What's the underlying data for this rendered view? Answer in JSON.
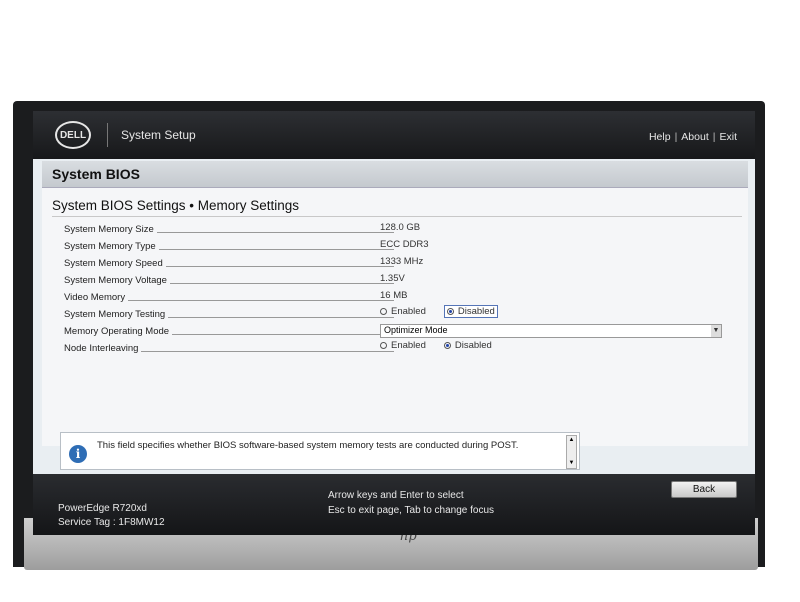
{
  "header": {
    "logo": "DELL",
    "title": "System Setup",
    "links": [
      "Help",
      "About",
      "Exit"
    ]
  },
  "section_title": "System BIOS",
  "subtitle": "System BIOS Settings • Memory Settings",
  "settings": {
    "memory_size": {
      "label": "System Memory Size",
      "value": "128.0 GB"
    },
    "memory_type": {
      "label": "System Memory Type",
      "value": "ECC DDR3"
    },
    "memory_speed": {
      "label": "System Memory Speed",
      "value": "1333 MHz"
    },
    "memory_voltage": {
      "label": "System Memory Voltage",
      "value": "1.35V"
    },
    "video_memory": {
      "label": "Video Memory",
      "value": "16 MB"
    },
    "memory_testing": {
      "label": "System Memory Testing",
      "options": [
        "Enabled",
        "Disabled"
      ],
      "selected": "Disabled"
    },
    "operating_mode": {
      "label": "Memory Operating Mode",
      "value": "Optimizer Mode"
    },
    "node_interleaving": {
      "label": "Node Interleaving",
      "options": [
        "Enabled",
        "Disabled"
      ],
      "selected": "Disabled"
    }
  },
  "help_text": "This field specifies whether BIOS software-based system memory tests are conducted during POST.",
  "footer": {
    "model": "PowerEdge R720xd",
    "service_tag": "Service Tag : 1F8MW12",
    "hint_line1": "Arrow keys and Enter to select",
    "hint_line2": "Esc to exit page, Tab to change focus",
    "back_label": "Back"
  },
  "bezel_logo": "hp"
}
